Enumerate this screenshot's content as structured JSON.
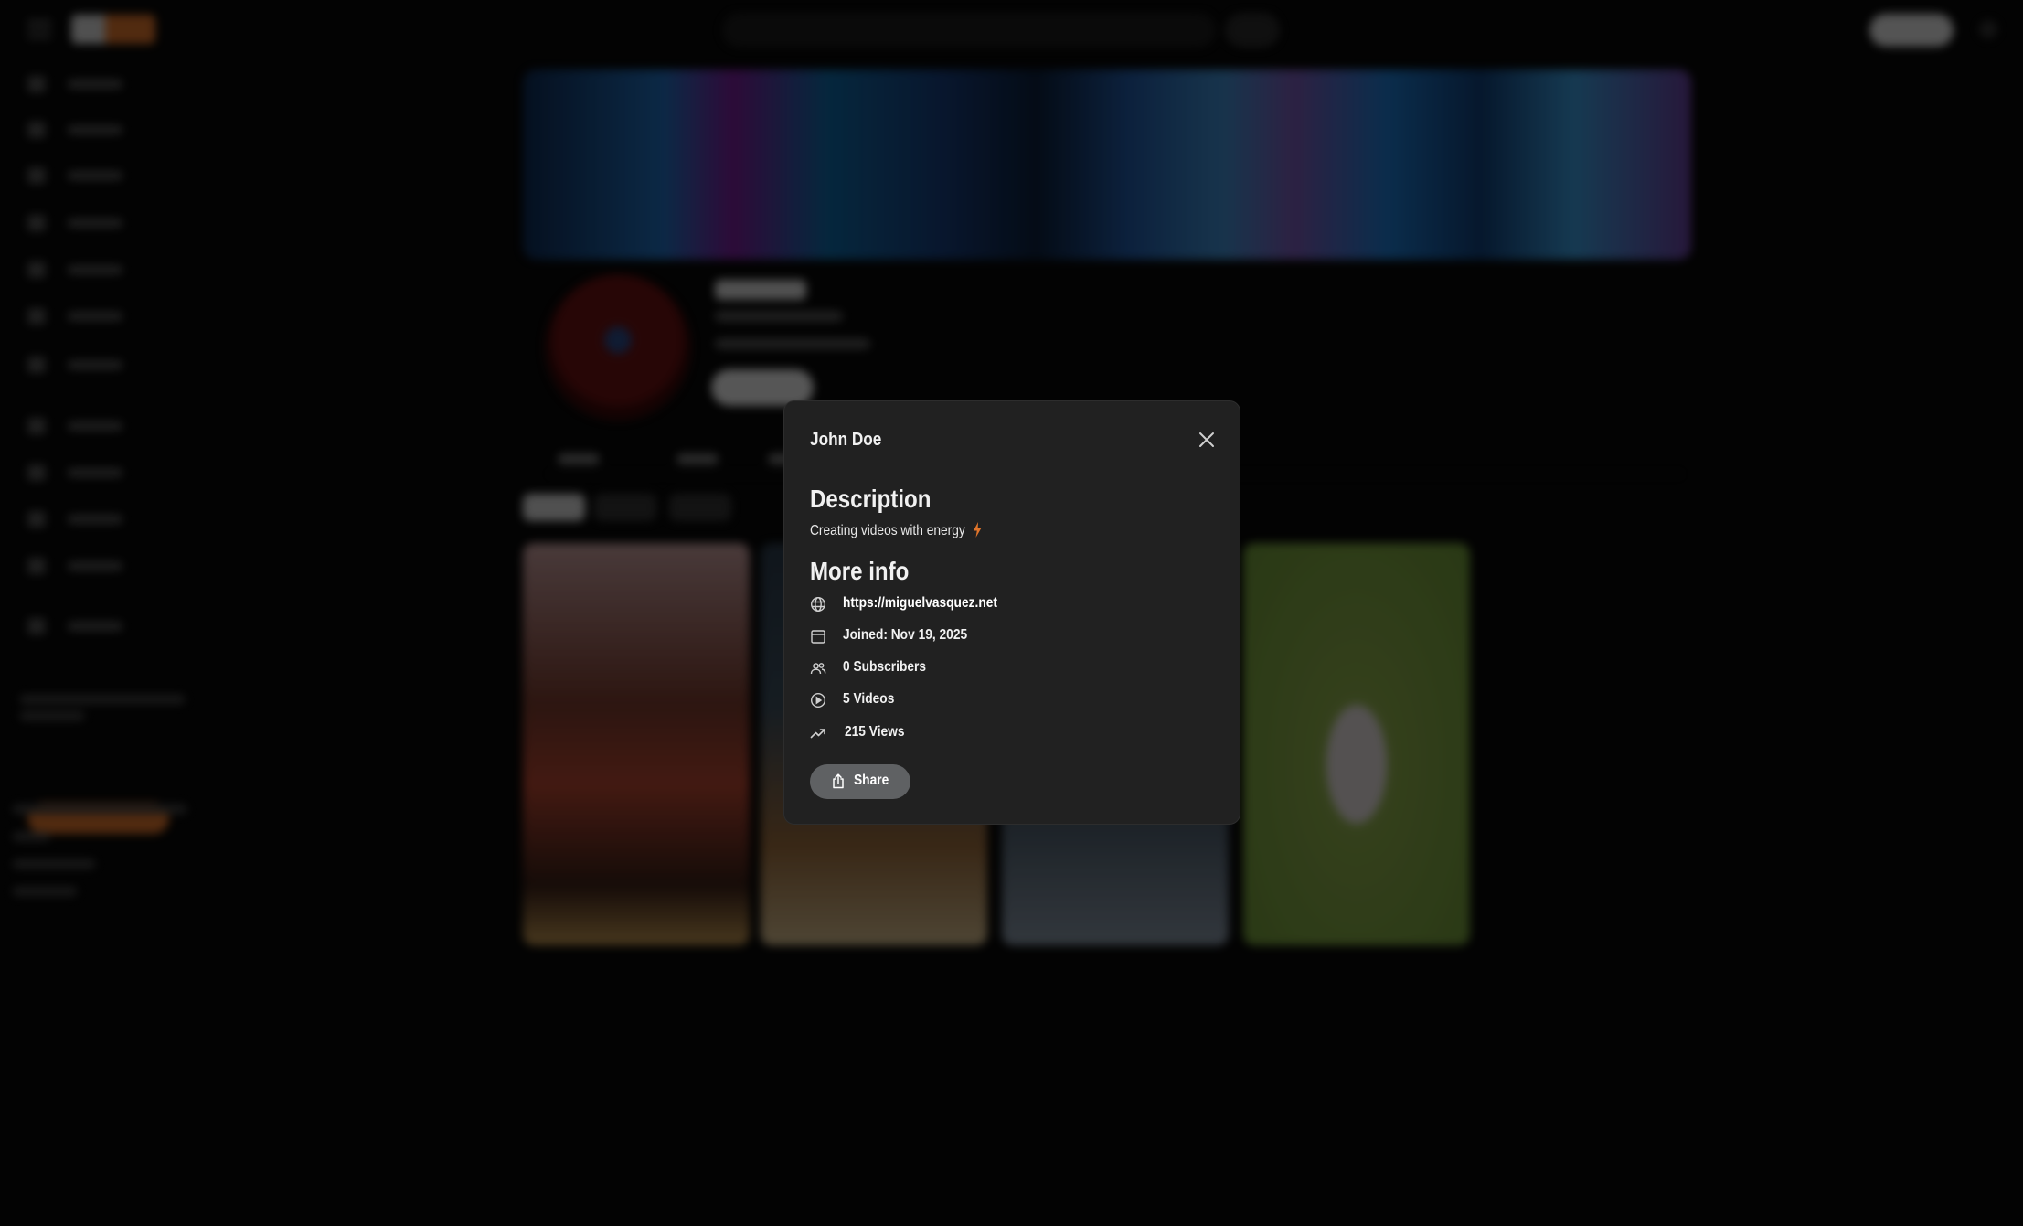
{
  "modal": {
    "title": "John Doe",
    "description_heading": "Description",
    "description_text": "Creating videos with energy",
    "more_info_heading": "More info",
    "info": {
      "website": "https://miguelvasquez.net",
      "joined": "Joined: Nov 19, 2025",
      "subscribers": "0 Subscribers",
      "videos": "5 Videos",
      "views": "215 Views"
    },
    "share_label": "Share",
    "icons": {
      "close": "close-icon",
      "bolt": "lightning-icon",
      "website": "globe-icon",
      "joined": "calendar-icon",
      "subscribers": "people-icon",
      "videos": "play-circle-icon",
      "views": "trending-up-icon",
      "share": "share-icon"
    }
  },
  "colors": {
    "modal_bg": "#212121",
    "accent": "#e0742a",
    "share_bg": "#5f6163"
  }
}
